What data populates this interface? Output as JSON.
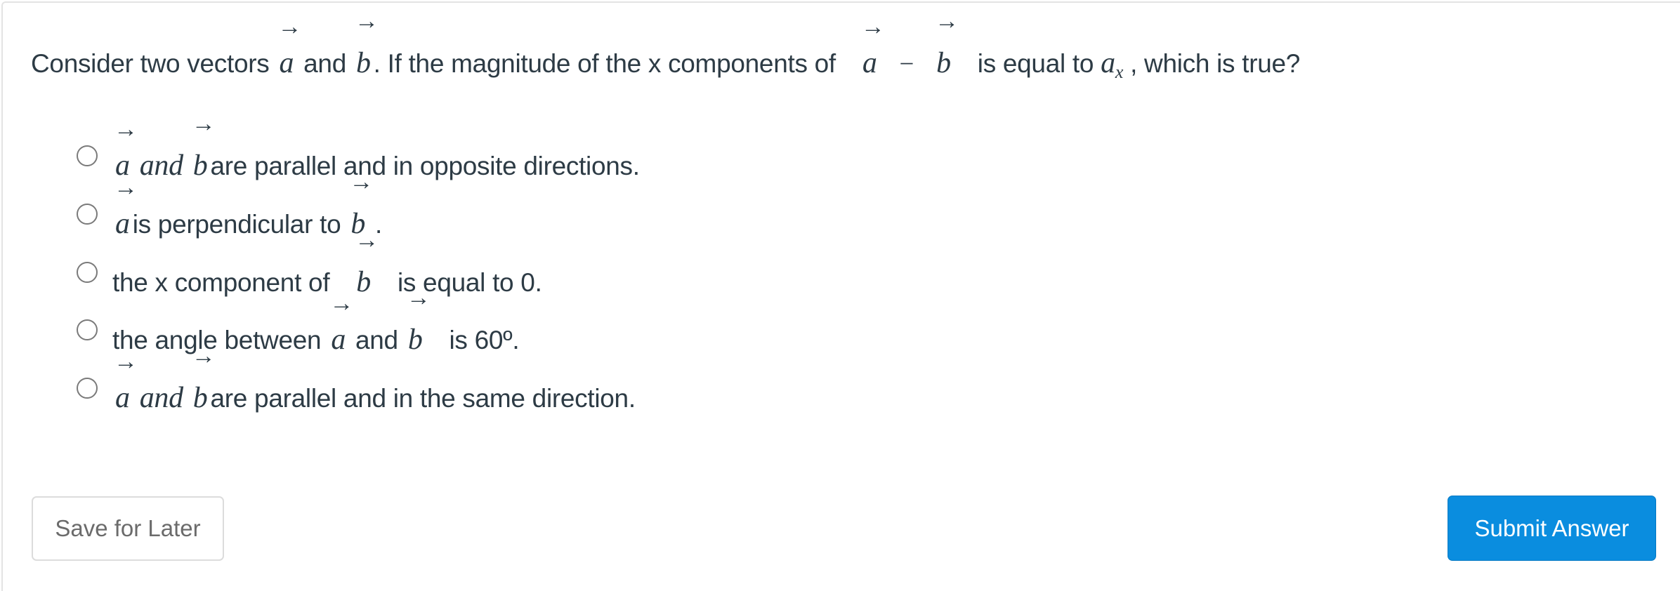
{
  "question": {
    "prefix": "Consider two vectors",
    "vec_a": "a",
    "and": "and",
    "vec_b": "b",
    "middle": ". If the magnitude of the x components of",
    "minus": "−",
    "after_diff": "is equal to",
    "ax_base": "a",
    "ax_sub": "x",
    "suffix": ", which is true?"
  },
  "arrow_glyph": "→",
  "options": [
    {
      "vec1": "a",
      "and_italic": "and",
      "vec2": "b",
      "text": "are parallel and in opposite directions."
    },
    {
      "vec1": "a",
      "text_mid": "is perpendicular to",
      "vec2": "b",
      "text_end": "."
    },
    {
      "text_start": "the x component of",
      "vec1": "b",
      "text_end": "is equal to 0."
    },
    {
      "text_start": "the angle between",
      "vec1": "a",
      "and": "and",
      "vec2": "b",
      "text_end": "is 60º."
    },
    {
      "vec1": "a",
      "and_italic": "and",
      "vec2": "b",
      "text": "are parallel and in the same direction."
    }
  ],
  "buttons": {
    "save_label": "Save for Later",
    "submit_label": "Submit Answer"
  },
  "colors": {
    "submit_bg": "#0a8ddf",
    "text": "#2d3b45"
  }
}
